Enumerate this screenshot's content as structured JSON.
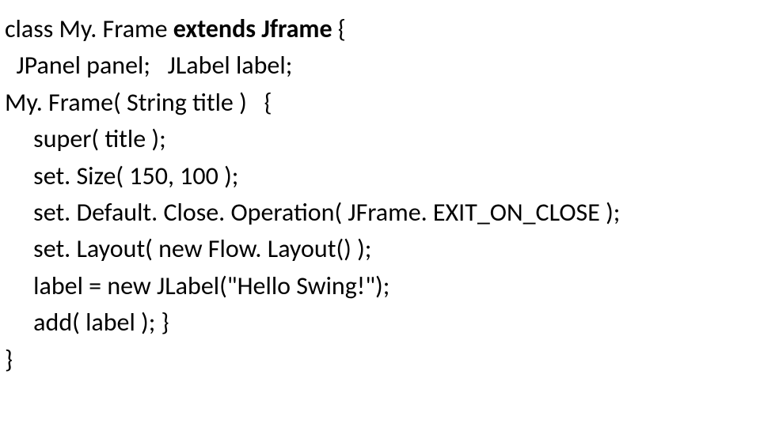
{
  "code": {
    "line1_part1": "class My. Frame",
    "line1_bold": " extends Jframe ",
    "line1_part2": "{",
    "line2": "  JPanel panel;   JLabel label;",
    "line3": "My. Frame( String title )   {",
    "line4": "     super( title );",
    "line5": "     set. Size( 150, 100 );",
    "line6": "     set. Default. Close. Operation( JFrame. EXIT_ON_CLOSE );",
    "line7": "     set. Layout( new Flow. Layout() );",
    "line8": "     label = new JLabel(\"Hello Swing!\");",
    "line9": "     add( label ); }",
    "line10": "}"
  }
}
